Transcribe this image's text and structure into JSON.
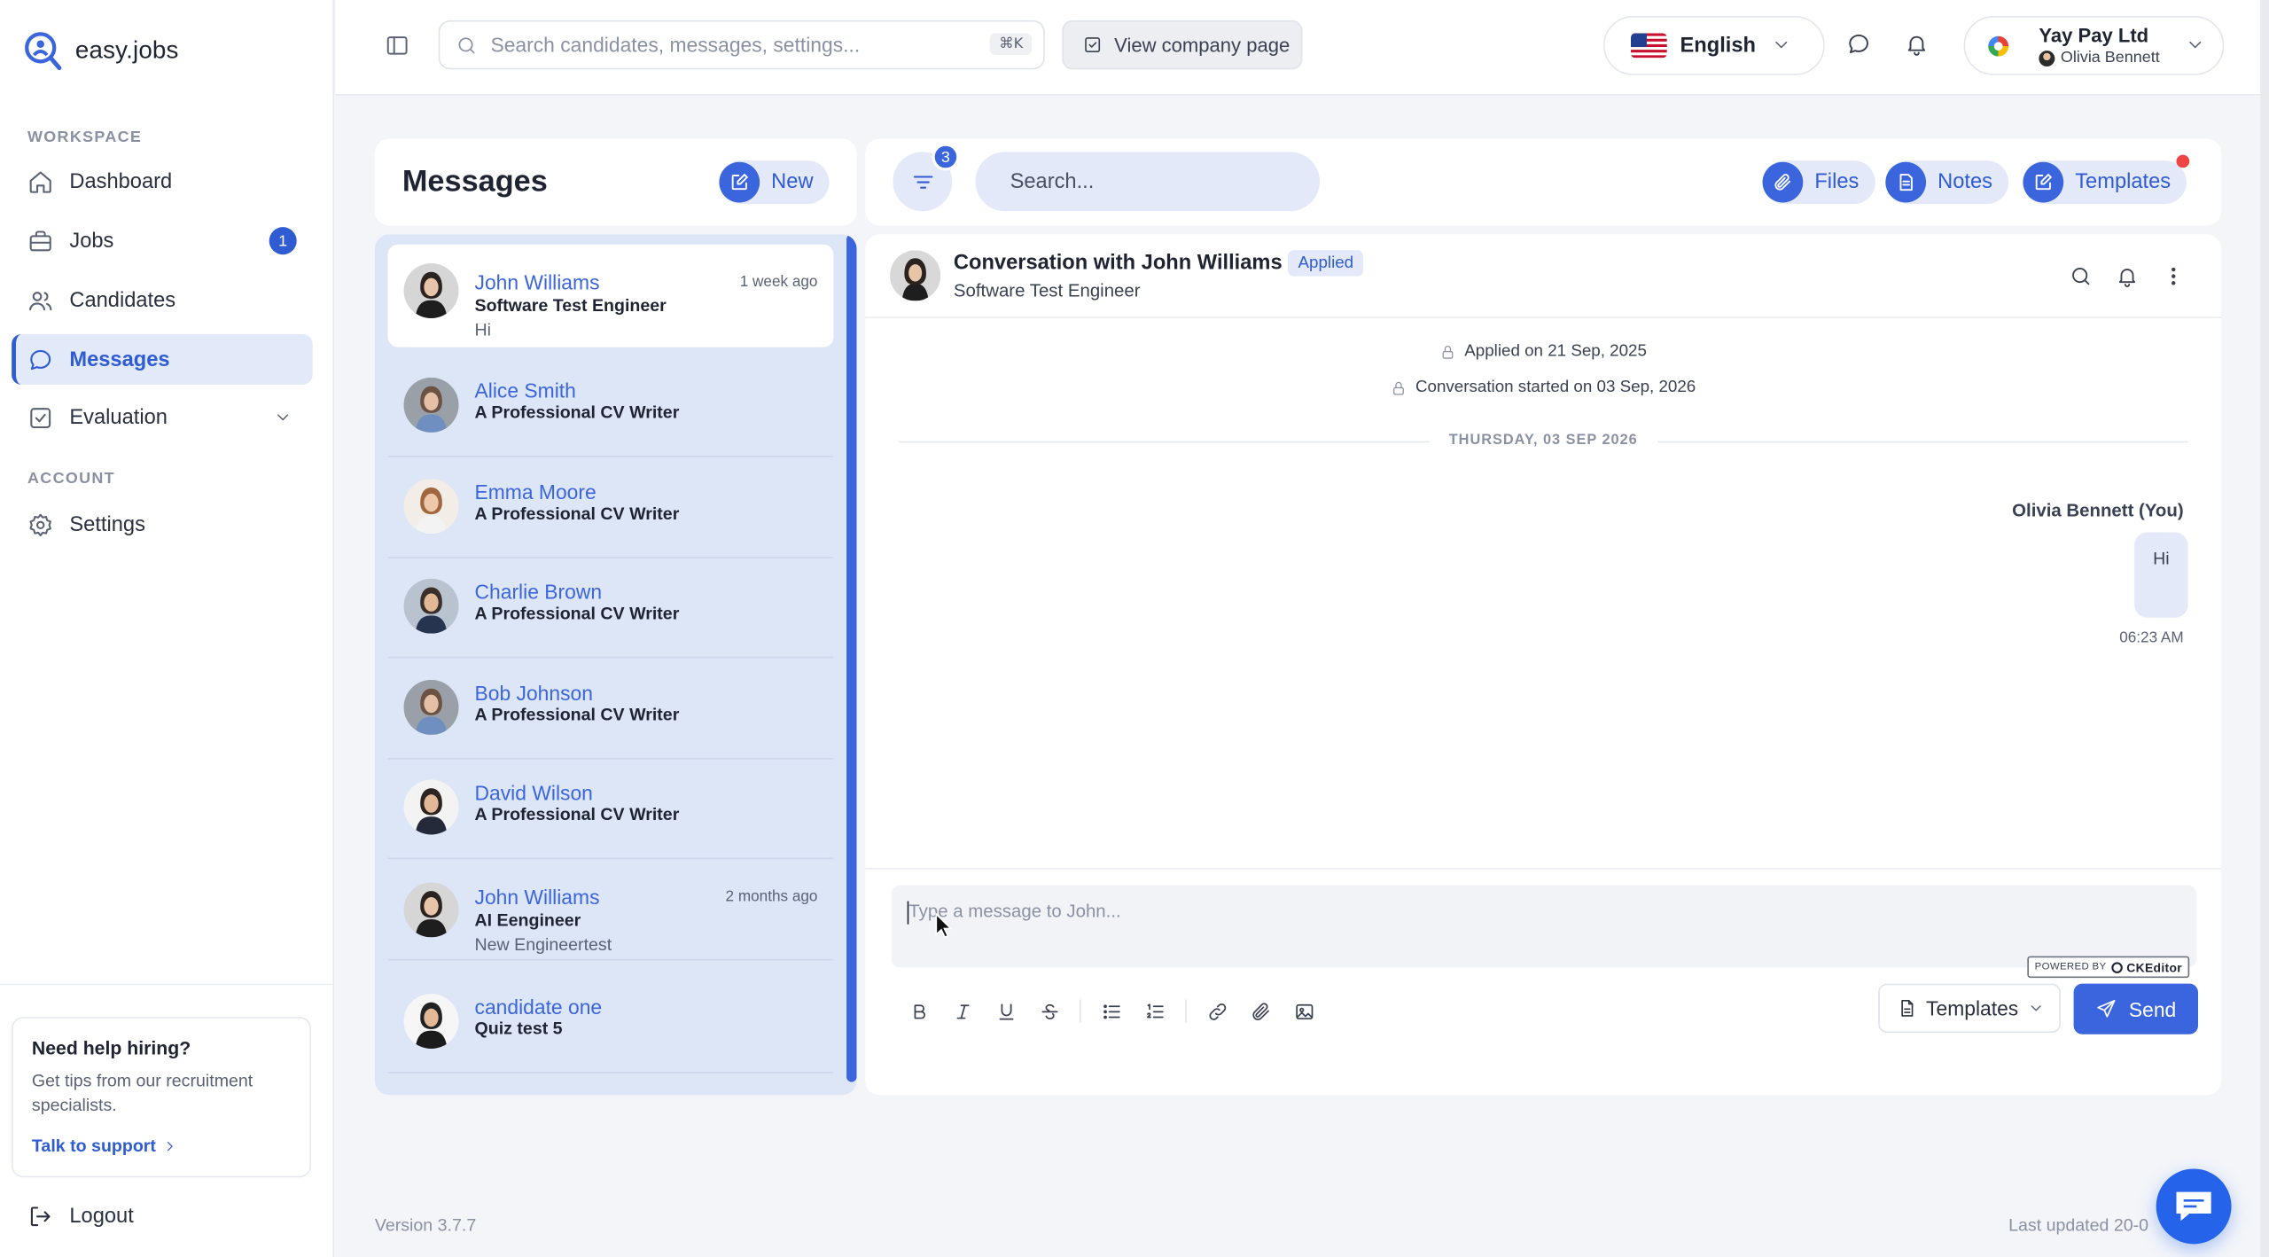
{
  "app": {
    "name": "easy.jobs",
    "version": "Version 3.7.7",
    "last_updated": "Last updated 20-0"
  },
  "colors": {
    "accent": "#3a65dc",
    "accent_soft": "#e3e9f9",
    "list_bg": "#dde6f7",
    "danger": "#ef4444"
  },
  "sidebar": {
    "workspace_label": "WORKSPACE",
    "account_label": "ACCOUNT",
    "items": [
      {
        "label": "Dashboard",
        "icon": "home-icon"
      },
      {
        "label": "Jobs",
        "icon": "briefcase-icon",
        "badge": "1"
      },
      {
        "label": "Candidates",
        "icon": "users-icon"
      },
      {
        "label": "Messages",
        "icon": "message-icon",
        "active": true
      },
      {
        "label": "Evaluation",
        "icon": "checklist-icon"
      }
    ],
    "settings_label": "Settings",
    "help": {
      "title": "Need help hiring?",
      "text": "Get tips from our recruitment specialists.",
      "link": "Talk to support"
    },
    "logout_label": "Logout"
  },
  "topbar": {
    "search_placeholder": "Search candidates, messages, settings...",
    "search_shortcut": "⌘K",
    "company_page_label": "View company page",
    "language": "English",
    "profile": {
      "company": "Yay Pay Ltd",
      "user": "Olivia Bennett"
    }
  },
  "messages_panel": {
    "title": "Messages",
    "new_label": "New"
  },
  "toolbar": {
    "filter_count": "3",
    "search_placeholder": "Search...",
    "files_label": "Files",
    "notes_label": "Notes",
    "templates_label": "Templates"
  },
  "conversations": [
    {
      "name": "John Williams",
      "role": "Software Test Engineer",
      "preview": "Hi",
      "time": "1 week ago",
      "active": true
    },
    {
      "name": "Alice Smith",
      "role": "A Professional CV Writer",
      "preview": "",
      "time": ""
    },
    {
      "name": "Emma Moore",
      "role": "A Professional CV Writer",
      "preview": "",
      "time": ""
    },
    {
      "name": "Charlie Brown",
      "role": "A Professional CV Writer",
      "preview": "",
      "time": ""
    },
    {
      "name": "Bob Johnson",
      "role": "A Professional CV Writer",
      "preview": "",
      "time": ""
    },
    {
      "name": "David Wilson",
      "role": "A Professional CV Writer",
      "preview": "",
      "time": ""
    },
    {
      "name": "John Williams",
      "role": "AI Eengineer",
      "preview": "New Engineertest",
      "time": "2 months ago"
    },
    {
      "name": "candidate one",
      "role": "Quiz test 5",
      "preview": "",
      "time": ""
    }
  ],
  "chat": {
    "title": "Conversation with John Williams",
    "status": "Applied",
    "subtitle": "Software Test Engineer",
    "applied_on": "Applied on 21 Sep, 2025",
    "started_on": "Conversation started on 03 Sep, 2026",
    "day_divider": "THURSDAY, 03 SEP 2026",
    "message": {
      "sender": "Olivia Bennett (You)",
      "text": "Hi",
      "time": "06:23 AM"
    },
    "composer_placeholder": "Type a message to John...",
    "ckeditor_prefix": "POWERED BY",
    "ckeditor_brand": "CKEditor",
    "templates_label": "Templates",
    "send_label": "Send"
  }
}
